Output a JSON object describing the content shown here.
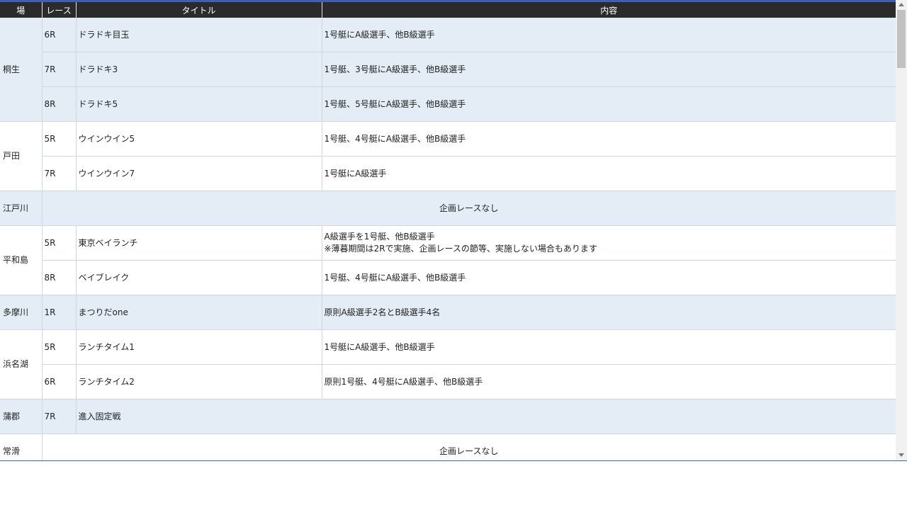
{
  "table": {
    "headers": [
      "場",
      "レース",
      "タイトル",
      "内容"
    ],
    "rows": [
      {
        "venue": "桐生",
        "race": "6R",
        "title": "ドラドキ目玉",
        "content": "1号艇にA級選手、他B級選手"
      },
      {
        "race": "7R",
        "title": "ドラドキ3",
        "content": "1号艇、3号艇にA級選手、他B級選手"
      },
      {
        "race": "8R",
        "title": "ドラドキ5",
        "content": "1号艇、5号艇にA級選手、他B級選手"
      },
      {
        "venue": "戸田",
        "race": "5R",
        "title": "ウインウイン5",
        "content": "1号艇、4号艇にA級選手、他B級選手"
      },
      {
        "race": "7R",
        "title": "ウインウイン7",
        "content": "1号艇にA級選手"
      },
      {
        "venue": "江戸川",
        "none": "企画レースなし"
      },
      {
        "venue": "平和島",
        "race": "5R",
        "title": "東京ベイランチ",
        "content_line1": "A級選手を1号艇、他B級選手",
        "content_line2": "※薄暮期間は2Rで実施、企画レースの節等、実施しない場合もあります"
      },
      {
        "race": "8R",
        "title": "ベイブレイク",
        "content": "1号艇、4号艇にA級選手、他B級選手"
      },
      {
        "venue": "多摩川",
        "race": "1R",
        "title": "まつりだone",
        "content": "原則A級選手2名とB級選手4名"
      },
      {
        "venue": "浜名湖",
        "race": "5R",
        "title": "ランチタイム1",
        "content": "1号艇にA級選手、他B級選手"
      },
      {
        "race": "6R",
        "title": "ランチタイム2",
        "content": "原則1号艇、4号艇にA級選手、他B級選手"
      },
      {
        "venue": "蒲郡",
        "race": "7R",
        "title": "進入固定戦",
        "content": ""
      },
      {
        "venue": "常滑",
        "none": "企画レースなし"
      }
    ]
  },
  "colors": {
    "header_bg": "#2b2b2b",
    "row_blue": "#e4ecf6",
    "row_white": "#ffffff",
    "top_accent": "#3b5fc0"
  }
}
